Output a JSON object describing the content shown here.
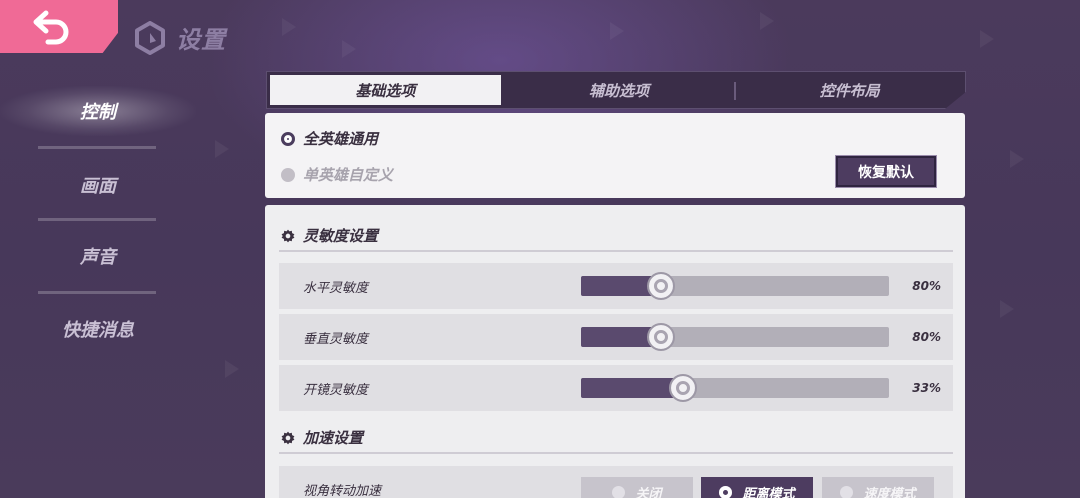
{
  "header": {
    "title": "设置"
  },
  "nav": {
    "items": [
      {
        "label": "控制",
        "active": true
      },
      {
        "label": "画面",
        "active": false
      },
      {
        "label": "声音",
        "active": false
      },
      {
        "label": "快捷消息",
        "active": false
      }
    ]
  },
  "tabs": [
    {
      "label": "基础选项",
      "active": true
    },
    {
      "label": "辅助选项",
      "active": false
    },
    {
      "label": "控件布局",
      "active": false
    }
  ],
  "mode": {
    "options": [
      {
        "label": "全英雄通用",
        "selected": true
      },
      {
        "label": "单英雄自定义",
        "selected": false
      }
    ],
    "reset_label": "恢复默认"
  },
  "sensitivity": {
    "title": "灵敏度设置",
    "rows": [
      {
        "label": "水平灵敏度",
        "value_text": "80%",
        "fill": 0.26
      },
      {
        "label": "垂直灵敏度",
        "value_text": "80%",
        "fill": 0.26
      },
      {
        "label": "开镜灵敏度",
        "value_text": "33%",
        "fill": 0.33
      }
    ]
  },
  "acceleration": {
    "title": "加速设置",
    "row_label": "视角转动加速",
    "options": [
      {
        "label": "关闭",
        "selected": false
      },
      {
        "label": "距离模式",
        "selected": true
      },
      {
        "label": "速度模式",
        "selected": false
      }
    ]
  },
  "colors": {
    "accent_pink": "#f06a96",
    "dark_purple": "#4d3c60",
    "background": "#4a3a5a"
  },
  "icons": {
    "back": "back-arrow-icon",
    "logo": "hexagon-logo-icon",
    "section": "gear-icon"
  }
}
